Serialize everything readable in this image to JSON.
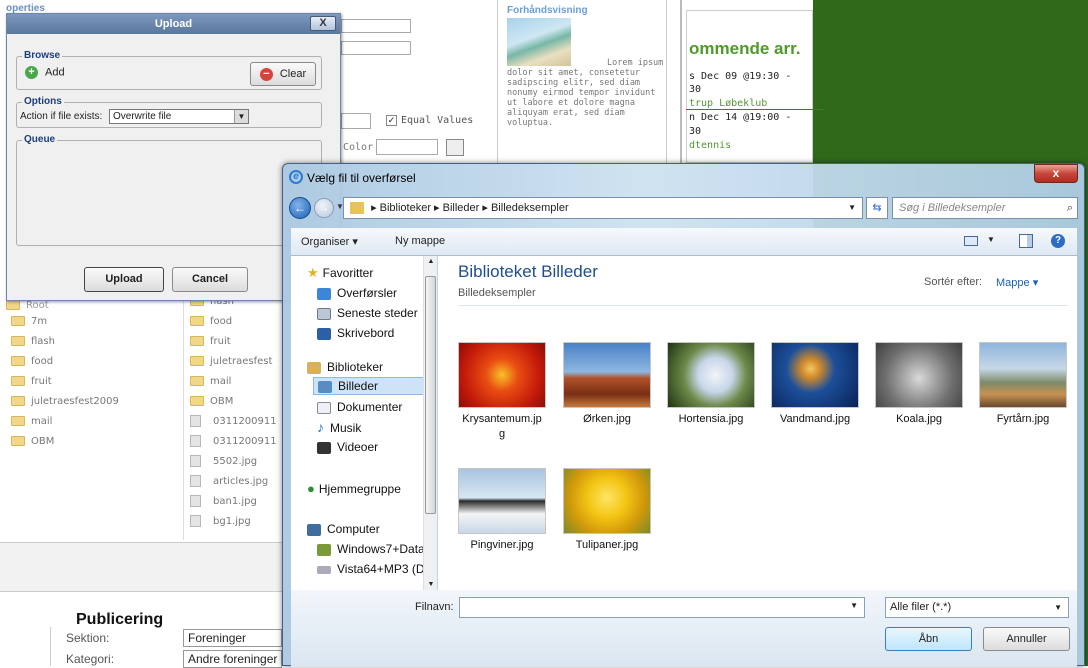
{
  "bg_page": {
    "properties_label": "operties",
    "equal_values": "Equal Values",
    "color_label": "Color",
    "preview_title": "Forhåndsvisning",
    "preview_text": "Lorem ipsum dolor sit amet, consetetur sadipscing elitr, sed diam nonumy eirmod tempor invidunt ut labore et dolore magna aliquyam erat, sed diam voluptua.",
    "events_title": "ommende arr.",
    "events": [
      "s Dec 09 @19:30 -",
      "30",
      "trup Løbeklub",
      "n Dec 14 @19:00 -",
      "30",
      "dtennis"
    ],
    "root_label": "Root",
    "left_folders": [
      "7m",
      "flash",
      "food",
      "fruit",
      "juletraesfest2009",
      "mail",
      "OBM"
    ],
    "right_items": [
      "flash",
      "food",
      "fruit",
      "juletraesfest",
      "mail",
      "OBM",
      "0311200911",
      "0311200911",
      "5502.jpg",
      "articles.jpg",
      "ban1.jpg",
      "bg1.jpg"
    ],
    "publ_title": "Publicering",
    "publ_rows": [
      {
        "label": "Sektion:",
        "value": "Foreninger"
      },
      {
        "label": "Kategori:",
        "value": "Andre foreninger"
      }
    ]
  },
  "upload": {
    "title": "Upload",
    "close": "X",
    "browse_legend": "Browse",
    "add_label": "Add",
    "clear_label": "Clear",
    "options_legend": "Options",
    "action_label": "Action if file exists:",
    "action_value": "Overwrite file",
    "queue_legend": "Queue",
    "upload_btn": "Upload",
    "cancel_btn": "Cancel"
  },
  "dialog": {
    "title": "Vælg fil til overførsel",
    "close": "x",
    "breadcrumb": [
      "Biblioteker",
      "Billeder",
      "Billedeksempler"
    ],
    "search_placeholder": "Søg i Billedeksempler",
    "toolbar": {
      "organize": "Organiser ▾",
      "new_folder": "Ny mappe"
    },
    "nav": {
      "favorites": "Favoritter",
      "fav_items": [
        "Overførsler",
        "Seneste steder",
        "Skrivebord"
      ],
      "libraries": "Biblioteker",
      "lib_items": [
        "Billeder",
        "Dokumenter",
        "Musik",
        "Videoer"
      ],
      "homegroup": "Hjemmegruppe",
      "computer": "Computer",
      "drives": [
        "Windows7+Data",
        "Vista64+MP3 (D:)"
      ]
    },
    "library_title": "Biblioteket Billeder",
    "library_sub": "Billedeksempler",
    "sort_label": "Sortér efter:",
    "sort_value": "Mappe",
    "files": [
      {
        "name": "Krysantemum.jpg",
        "name2": "g",
        "line1": "Krysantemum.jp"
      },
      {
        "name": "Ørken.jpg"
      },
      {
        "name": "Hortensia.jpg"
      },
      {
        "name": "Vandmand.jpg"
      },
      {
        "name": "Koala.jpg"
      },
      {
        "name": "Fyrtårn.jpg"
      },
      {
        "name": "Pingviner.jpg"
      },
      {
        "name": "Tulipaner.jpg"
      }
    ],
    "filename_label": "Filnavn:",
    "filetype_value": "Alle filer (*.*)",
    "open_btn": "Åbn",
    "cancel_btn": "Annuller"
  }
}
